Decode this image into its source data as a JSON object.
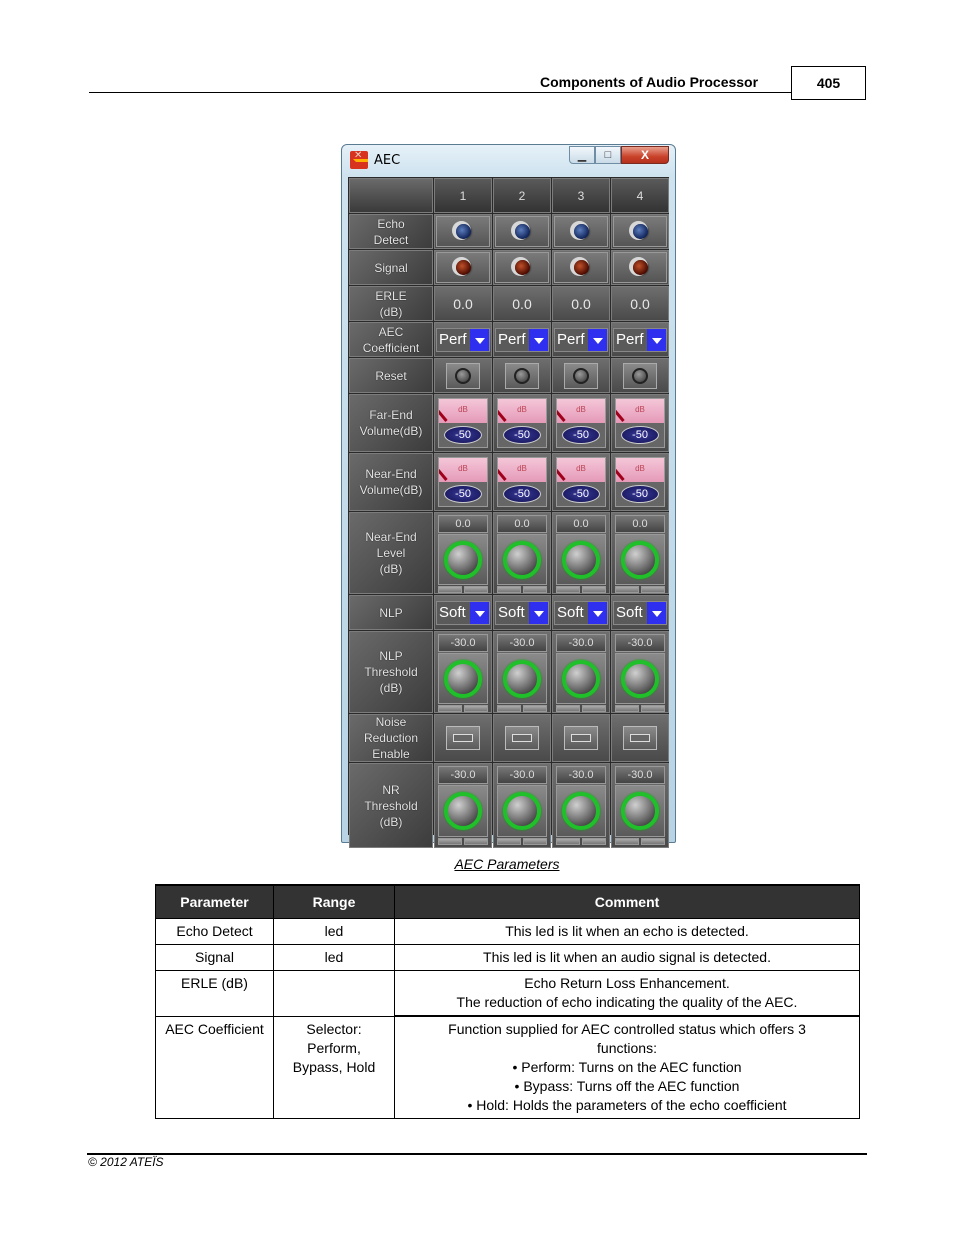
{
  "header": {
    "section_title": "Components of Audio Processor",
    "page_number": "405"
  },
  "window": {
    "title": "AEC",
    "controls": {
      "minimize": "—",
      "maximize": "□",
      "close": "X"
    },
    "columns": [
      "1",
      "2",
      "3",
      "4"
    ],
    "rows": {
      "echo_detect": {
        "label": "Echo\nDetect",
        "led_color": "#1f3f8a",
        "lit": false
      },
      "signal": {
        "label": "Signal",
        "led_color": "#8a1a00",
        "lit": false
      },
      "erle": {
        "label": "ERLE\n(dB)",
        "values": [
          "0.0",
          "0.0",
          "0.0",
          "0.0"
        ]
      },
      "aec_coefficient": {
        "label": "AEC\nCoefficient",
        "values": [
          "Perf",
          "Perf",
          "Perf",
          "Perf"
        ]
      },
      "reset": {
        "label": "Reset"
      },
      "far_end_volume": {
        "label": "Far-End\nVolume(dB)",
        "scale": "dB",
        "values": [
          "-50",
          "-50",
          "-50",
          "-50"
        ]
      },
      "near_end_volume": {
        "label": "Near-End\nVolume(dB)",
        "scale": "dB",
        "values": [
          "-50",
          "-50",
          "-50",
          "-50"
        ]
      },
      "near_end_level": {
        "label": "Near-End\nLevel\n(dB)",
        "values": [
          "0.0",
          "0.0",
          "0.0",
          "0.0"
        ]
      },
      "nlp": {
        "label": "NLP",
        "values": [
          "Soft",
          "Soft",
          "Soft",
          "Soft"
        ]
      },
      "nlp_threshold": {
        "label": "NLP\nThreshold\n(dB)",
        "values": [
          "-30.0",
          "-30.0",
          "-30.0",
          "-30.0"
        ]
      },
      "noise_reduction_enable": {
        "label": "Noise\nReduction\nEnable"
      },
      "nr_threshold": {
        "label": "NR\nThreshold\n(dB)",
        "values": [
          "-30.0",
          "-30.0",
          "-30.0",
          "-30.0"
        ]
      }
    },
    "accent_colors": {
      "knob_ring": "#1fc02a",
      "dropdown_button": "#2f2ff0",
      "close_button": "#c9422a"
    }
  },
  "caption": "AEC Parameters",
  "table": {
    "headers": [
      "Parameter",
      "Range",
      "Comment"
    ],
    "rows": [
      {
        "parameter": "Echo Detect",
        "range": "led",
        "comment": [
          "This led is lit when an echo is detected."
        ]
      },
      {
        "parameter": "Signal",
        "range": "led",
        "comment": [
          "This led is lit when an audio signal is detected."
        ]
      },
      {
        "parameter": "ERLE (dB)",
        "range": "",
        "comment": [
          "Echo Return Loss Enhancement.",
          "The reduction of echo indicating the quality of the AEC."
        ]
      },
      {
        "parameter": "AEC Coefficient",
        "range": "Selector:\nPerform,\nBypass, Hold",
        "comment": [
          "Function supplied for AEC controlled status which offers 3 functions:"
        ],
        "bullets": [
          "Perform: Turns on the AEC function",
          "Bypass: Turns off the AEC function",
          "Hold: Holds the parameters of the echo coefficient"
        ]
      }
    ]
  },
  "footer": {
    "copyright": "© 2012 ATEÏS"
  }
}
